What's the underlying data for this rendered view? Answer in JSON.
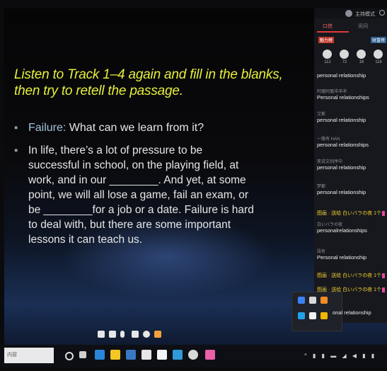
{
  "slide": {
    "title": "Listen to Track 1–4 again and fill in the blanks, then try to retell the passage.",
    "bullet1_prefix": "Failure: ",
    "bullet1_rest": "What can we learn from it?",
    "bullet2": "In life, there’s a lot of pressure to be\nsuccessful in school, on the playing field, at\nwork, and in our ________. And yet, at some\npoint, we will all lose a game, fail an exam, or\nbe ________for a job or a date. Failure is hard\nto deal with, but there are some important\nlessons it can teach us."
  },
  "panel": {
    "header_mode": "主持模式",
    "tab_active": "口信",
    "tab_other": "讯问",
    "tag_left": "魅力榜",
    "tag_right": "财富榜",
    "avatar_counts": [
      "112",
      "72",
      "16",
      "116"
    ],
    "messages": [
      {
        "name": "",
        "body": "personal relationship"
      },
      {
        "name": "阿璐阿璐冲冲冲",
        "body": "Personal relationships"
      },
      {
        "name": "艾斯",
        "body": "personal relationship"
      },
      {
        "name": "一路有 HAN",
        "body": "personal relationships"
      },
      {
        "name": "笑说文创序中",
        "body": "personal relationship"
      },
      {
        "name": "梦都",
        "body": "personal relationship"
      },
      {
        "gift": "图画 · 送给 白いバラの夜 1个"
      },
      {
        "name": "白いバラの夜",
        "body": "personalrelationships"
      },
      {
        "name": "段有",
        "body": "Personal relationship"
      },
      {
        "gift": "图画 · 送给 白いバラの夜 1个"
      },
      {
        "gift": "图画 · 送给 白いバラの夜 1个"
      }
    ],
    "trailing": "onal relationship"
  },
  "taskbar": {
    "search_placeholder": "内容",
    "tray_text": "^ ▮ ▮ ▬ ◢ ◀ ▮ ▮"
  },
  "colors": {
    "title_yellow": "#e7ef3a",
    "tab_red": "#e0393e",
    "gift_yellow": "#f2d130"
  }
}
